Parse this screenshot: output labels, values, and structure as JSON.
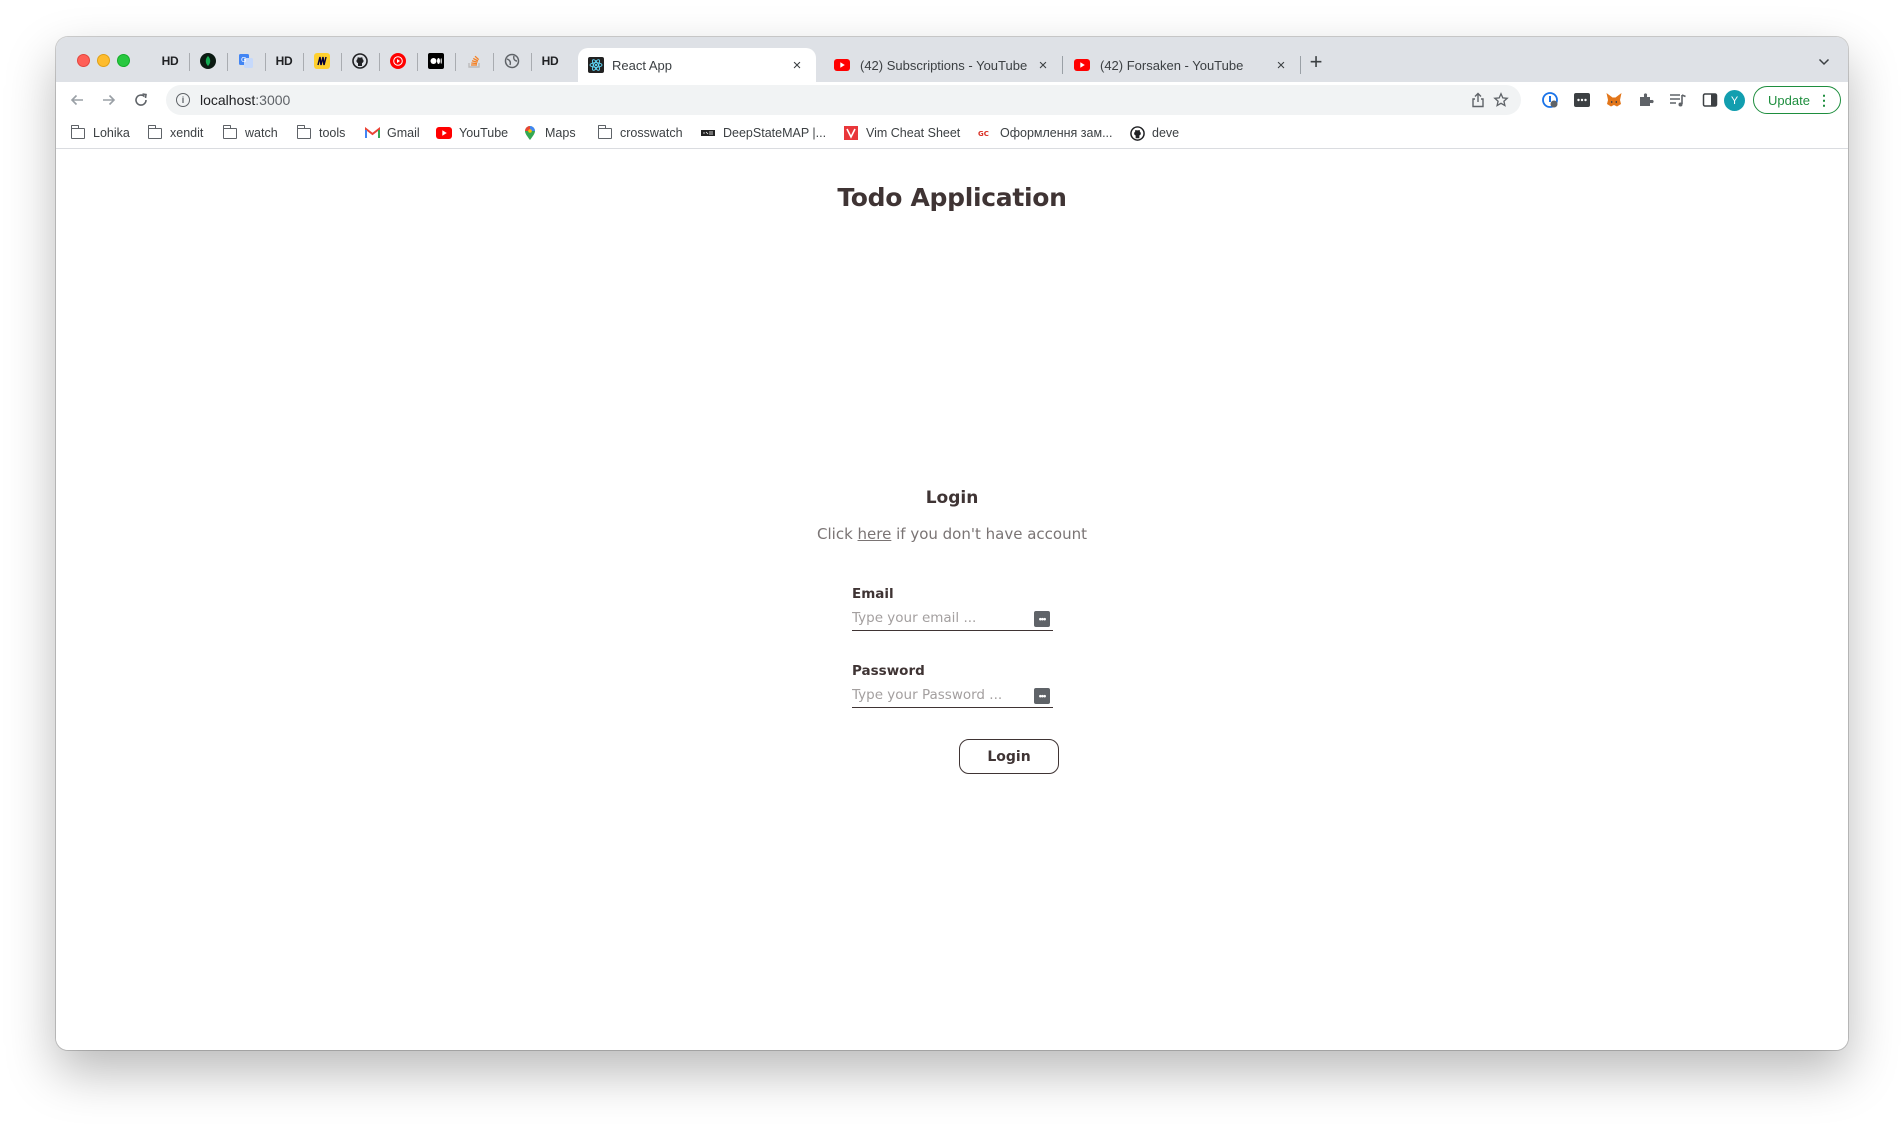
{
  "browser": {
    "pinned_tabs": [
      {
        "icon": "hd-icon",
        "text": "HD"
      },
      {
        "icon": "leaf-icon",
        "text": ""
      },
      {
        "icon": "translate-icon",
        "text": ""
      },
      {
        "icon": "hd-icon",
        "text": "HD"
      },
      {
        "icon": "miro-icon",
        "text": ""
      },
      {
        "icon": "github-icon",
        "text": ""
      },
      {
        "icon": "youtube-music-icon",
        "text": ""
      },
      {
        "icon": "medium-icon",
        "text": ""
      },
      {
        "icon": "stack-overflow-icon",
        "text": ""
      },
      {
        "icon": "globe-icon",
        "text": ""
      },
      {
        "icon": "hd-icon",
        "text": "HD"
      }
    ],
    "tabs": [
      {
        "title": "React App",
        "active": true,
        "icon": "react-icon"
      },
      {
        "title": "(42) Subscriptions - YouTube",
        "active": false,
        "icon": "youtube-icon"
      },
      {
        "title": "(42) Forsaken - YouTube",
        "active": false,
        "icon": "youtube-icon"
      }
    ],
    "close_glyph": "×",
    "new_tab_glyph": "+",
    "url_host": "localhost",
    "url_port": ":3000",
    "avatar_letter": "Y",
    "update_label": "Update",
    "accent_color": "#1e8e3e",
    "avatar_color": "#129eaf"
  },
  "bookmarks": [
    {
      "label": "Lohika",
      "icon": "folder-icon"
    },
    {
      "label": "xendit",
      "icon": "folder-icon"
    },
    {
      "label": "watch",
      "icon": "folder-icon"
    },
    {
      "label": "tools",
      "icon": "folder-icon"
    },
    {
      "label": "Gmail",
      "icon": "gmail-icon"
    },
    {
      "label": "YouTube",
      "icon": "youtube-icon"
    },
    {
      "label": "Maps",
      "icon": "maps-icon"
    },
    {
      "label": "crosswatch",
      "icon": "folder-icon"
    },
    {
      "label": "DeepStateMAP |...",
      "icon": "deepstate-icon"
    },
    {
      "label": "Vim Cheat Sheet",
      "icon": "vim-icon"
    },
    {
      "label": "Оформлення зам...",
      "icon": "shop-icon"
    },
    {
      "label": "deve",
      "icon": "github-icon"
    }
  ],
  "page": {
    "app_title": "Todo Application",
    "login_title": "Login",
    "hint_prefix": "Click ",
    "hint_link": "here",
    "hint_suffix": " if you don't have account",
    "email_label": "Email",
    "email_placeholder": "Type your email ...",
    "password_label": "Password",
    "password_placeholder": "Type your Password ...",
    "login_button": "Login",
    "text_color": "#3f3434"
  }
}
